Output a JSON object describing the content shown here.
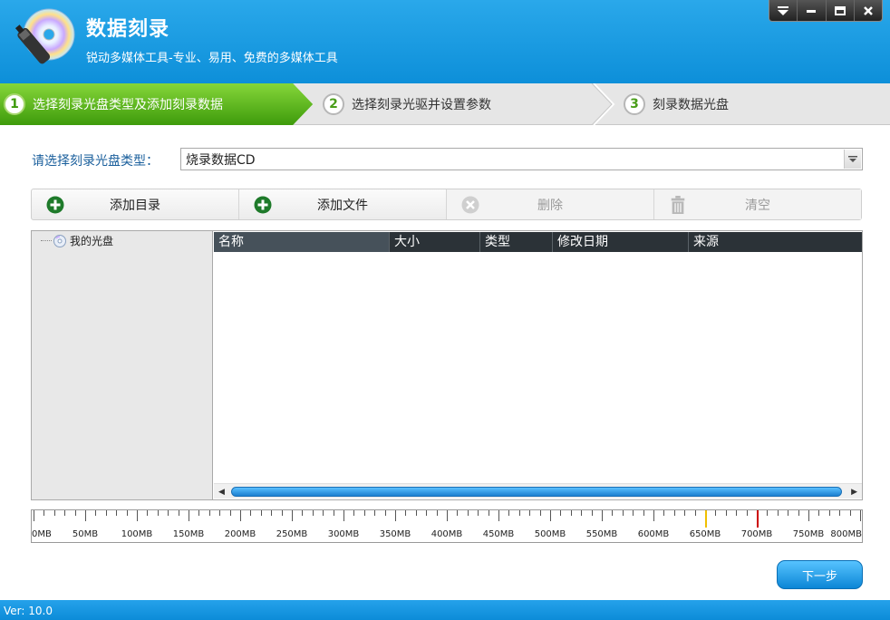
{
  "app": {
    "title": "数据刻录",
    "subtitle": "锐动多媒体工具-专业、易用、免费的多媒体工具",
    "accent_color": "#0d8fd9"
  },
  "window_controls": [
    {
      "name": "menu-icon"
    },
    {
      "name": "minimize-icon"
    },
    {
      "name": "maximize-icon"
    },
    {
      "name": "close-icon"
    }
  ],
  "steps": [
    {
      "number": "1",
      "label": "选择刻录光盘类型及添加刻录数据",
      "active": true
    },
    {
      "number": "2",
      "label": "选择刻录光驱并设置参数",
      "active": false
    },
    {
      "number": "3",
      "label": "刻录数据光盘",
      "active": false
    }
  ],
  "disc_type": {
    "label": "请选择刻录光盘类型：",
    "selected": "烧录数据CD"
  },
  "toolbar": {
    "add_dir": "添加目录",
    "add_file": "添加文件",
    "delete": "删除",
    "clear": "清空"
  },
  "tree": {
    "root": "我的光盘"
  },
  "list": {
    "columns": [
      "名称",
      "大小",
      "类型",
      "修改日期",
      "来源"
    ],
    "rows": []
  },
  "capacity_ruler": {
    "labels": [
      "0MB",
      "50MB",
      "100MB",
      "150MB",
      "200MB",
      "250MB",
      "300MB",
      "350MB",
      "400MB",
      "450MB",
      "500MB",
      "550MB",
      "600MB",
      "650MB",
      "700MB",
      "750MB",
      "800MB"
    ],
    "max_mb": 800,
    "markers": [
      {
        "value_mb": 650,
        "color": "#f0c000"
      },
      {
        "value_mb": 700,
        "color": "#cc0000"
      }
    ]
  },
  "next_button": "下一步",
  "status": {
    "version": "Ver: 10.0"
  }
}
